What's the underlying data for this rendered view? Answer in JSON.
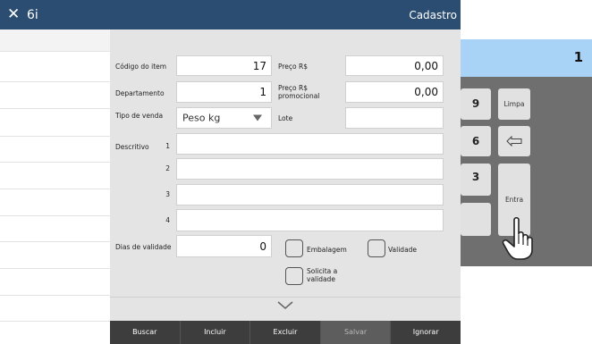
{
  "titlebar": {
    "close_icon": "close-icon",
    "title": "6i",
    "right_text": "Cadastro"
  },
  "form": {
    "codigo_label": "Código do item",
    "codigo_value": "17",
    "preco_label": "Preço R$",
    "preco_value": "0,00",
    "departamento_label": "Departamento",
    "departamento_value": "1",
    "preco_promo_label_1": "Preço R$",
    "preco_promo_label_2": "promocional",
    "preco_promo_value": "0,00",
    "tipo_label": "Tipo de venda",
    "tipo_value": "Peso kg",
    "lote_label": "Lote",
    "lote_value": "",
    "descritivo_label": "Descritivo",
    "line_numbers": [
      "1",
      "2",
      "3",
      "4"
    ],
    "dias_label": "Dias de validade",
    "dias_value": "0",
    "embalagem_label": "Embalagem",
    "validade_label": "Validade",
    "solicita_label_1": "Solicita a",
    "solicita_label_2": "validade"
  },
  "footer": {
    "buscar": "Buscar",
    "incluir": "Incluir",
    "excluir": "Excluir",
    "salvar": "Salvar",
    "ignorar": "Ignorar"
  },
  "keypad": {
    "display_value": "1",
    "key_9": "9",
    "key_6": "6",
    "key_3": "3",
    "limpa": "Limpa",
    "entra": "Entra",
    "backspace_icon": "backspace-arrow-icon",
    "hand_icon": "hand-pointer-icon"
  },
  "colors": {
    "titlebar": "#2b4d72",
    "form_bg": "#e4e4e4",
    "keypad_bg": "#6f6f6f",
    "display_bg": "#a9d2f7",
    "footer_bg": "#3d3d3d"
  }
}
